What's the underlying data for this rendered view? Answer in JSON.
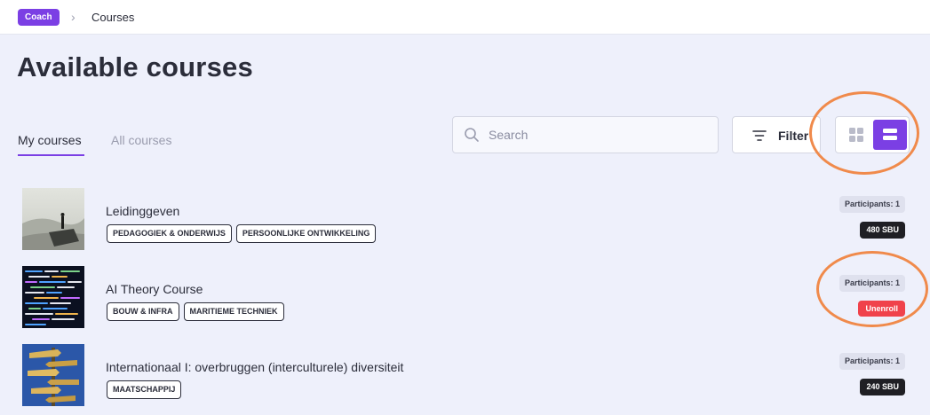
{
  "breadcrumb": {
    "root": "Coach",
    "separator": "›",
    "current": "Courses"
  },
  "page": {
    "title": "Available courses"
  },
  "tabs": [
    {
      "label": "My courses",
      "active": true
    },
    {
      "label": "All courses",
      "active": false
    }
  ],
  "search": {
    "placeholder": "Search",
    "value": ""
  },
  "filter": {
    "label": "Filter"
  },
  "view_toggle": {
    "grid_icon": "grid-icon",
    "list_icon": "list-icon",
    "active": "list"
  },
  "courses": [
    {
      "title": "Leidinggeven",
      "tags": [
        "PEDAGOGIEK & ONDERWIJS",
        "PERSOONLIJKE ONTWIKKELING"
      ],
      "participants": "Participants: 1",
      "action": "480 SBU",
      "action_type": "sbu"
    },
    {
      "title": "AI Theory Course",
      "tags": [
        "BOUW & INFRA",
        "MARITIEME TECHNIEK"
      ],
      "participants": "Participants: 1",
      "action": "Unenroll",
      "action_type": "unenroll"
    },
    {
      "title": "Internationaal I: overbruggen (interculturele) diversiteit",
      "tags": [
        "MAATSCHAPPIJ"
      ],
      "participants": "Participants: 1",
      "action": "240 SBU",
      "action_type": "sbu"
    }
  ],
  "colors": {
    "accent": "#7b3fe4",
    "background": "#eef0fb",
    "annotation": "#f08a4b",
    "danger": "#f0424b"
  }
}
